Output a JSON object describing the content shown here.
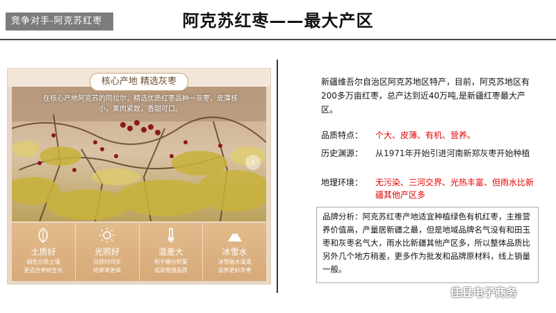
{
  "tag": "竞争对手-阿克苏红枣",
  "title": "阿克苏红枣——最大产区",
  "card": {
    "pill": "核心产地 精选灰枣",
    "photo_text": "在核心产地阿克苏的同拉尔，精选优质红枣品种一灰枣，皮薄核小，果肉紧致，香甜可口。",
    "features": [
      {
        "icon": "leaf-icon",
        "name": "土质好",
        "desc1": "碱性沙质土壤",
        "desc2": "更适合枣树生长"
      },
      {
        "icon": "sun-icon",
        "name": "光照好",
        "desc1": "日照时间长",
        "desc2": "结果率更高"
      },
      {
        "icon": "thermometer-icon",
        "name": "温差大",
        "desc1": "利于糖分积累",
        "desc2": "成就香甜品质"
      },
      {
        "icon": "mountain-icon",
        "name": "冰雪水",
        "desc1": "冰雪融水灌溉",
        "desc2": "滋养更好灰枣"
      }
    ]
  },
  "intro": "新疆维吾尔自治区阿克苏地区特产，目前，阿克苏地区有200多万亩红枣，总产达到近40万吨,是新疆红枣最大产区。",
  "rows": [
    {
      "label": "品质特点：",
      "value": "个大、皮薄、有机、营养。"
    },
    {
      "label": "历史渊源：",
      "value": "从1971年开始引进河南新郑灰枣开始种植"
    },
    {
      "label": "地理环境：",
      "value": "无污染、三河交界、光热丰富、但雨水比新疆其他产区多"
    }
  ],
  "brand_analysis": "品牌分析：阿克苏红枣产地适宜种植绿色有机红枣，主推营养价值高，产量居新疆之最，但是地域品牌名气没有和田玉枣和灰枣名气大，雨水比新疆其他产区多，所以整体品质比另外几个地方稍差，更多作为批发和品牌原材料，线上销量一般。",
  "watermark": "佳县电子商务",
  "colors": {
    "accent_red": "#e60000",
    "tag_gray": "#7c7c7c",
    "feature_tan": "#d7a978"
  }
}
